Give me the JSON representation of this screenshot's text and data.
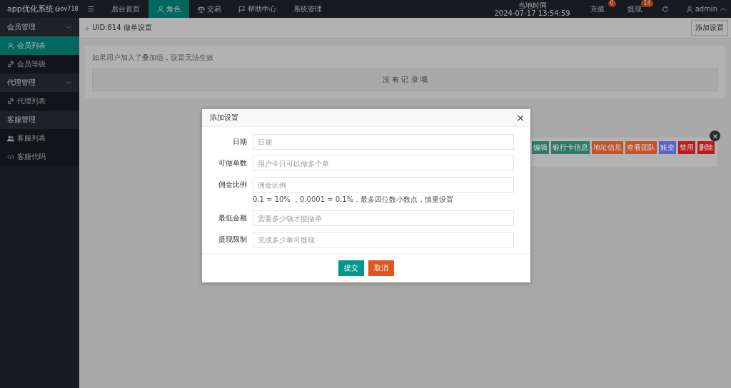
{
  "header": {
    "logo": "app优化系统",
    "logo_tag": "@ov718",
    "menu_toggle": "☰",
    "nav": [
      {
        "label": "后台首页",
        "selected": false
      },
      {
        "label": "角色",
        "selected": true
      },
      {
        "label": "交易",
        "selected": false
      },
      {
        "label": "帮助中心",
        "selected": false
      },
      {
        "label": "系统管理",
        "selected": false
      }
    ],
    "clock_label": "当地时间",
    "clock": "2024-07-17 13:54:59",
    "counters": [
      {
        "label": "充值",
        "badge": "0"
      },
      {
        "label": "提现",
        "badge": "14"
      }
    ],
    "user": "admin"
  },
  "sidebar": [
    {
      "label": "会员管理",
      "kind": "group",
      "expanded": true,
      "selected": false
    },
    {
      "label": "会员列表",
      "kind": "item",
      "selected": true
    },
    {
      "label": "会员等级",
      "kind": "item",
      "selected": false
    },
    {
      "label": "代理管理",
      "kind": "group",
      "expanded": true,
      "selected": false
    },
    {
      "label": "代理列表",
      "kind": "item",
      "selected": false
    },
    {
      "label": "客服管理",
      "kind": "group",
      "selected": false
    },
    {
      "label": "客服列表",
      "kind": "item",
      "selected": false
    },
    {
      "label": "客服代码",
      "kind": "item",
      "selected": false
    }
  ],
  "breadcrumb_sep": "»",
  "breadcrumb": "UID:814 做单设置",
  "add_button": "添加设置",
  "notice": "如果用户加入了叠加组，设置无法生效",
  "empty": "没 有 记 录 哦",
  "actions": [
    {
      "label": "编辑",
      "color": "#2e7a66"
    },
    {
      "label": "银行卡信息",
      "color": "#2e7a66"
    },
    {
      "label": "地址信息",
      "color": "#c0532a"
    },
    {
      "label": "查看团队",
      "color": "#c0532a"
    },
    {
      "label": "账变",
      "color": "#5a62c8"
    },
    {
      "label": "禁用",
      "color": "#b81c1c"
    },
    {
      "label": "删除",
      "color": "#b81c1c"
    }
  ],
  "dialog": {
    "title": "添加设置",
    "close": "×",
    "fields": [
      {
        "label": "日期",
        "placeholder": "日期"
      },
      {
        "label": "可做单数",
        "placeholder": "用户今日可以做多个单"
      },
      {
        "label": "佣金比例",
        "placeholder": "佣金比例",
        "hint": "0.1 = 10% ，0.0001 = 0.1%，最多四位数小数点，慎重设置"
      },
      {
        "label": "最低金额",
        "placeholder": "需要多少钱才能做单"
      },
      {
        "label": "提现限制",
        "placeholder": "完成多少单可提现"
      }
    ],
    "buttons": [
      {
        "label": "提交",
        "kind": "primary"
      },
      {
        "label": "取消",
        "kind": "danger"
      }
    ]
  }
}
